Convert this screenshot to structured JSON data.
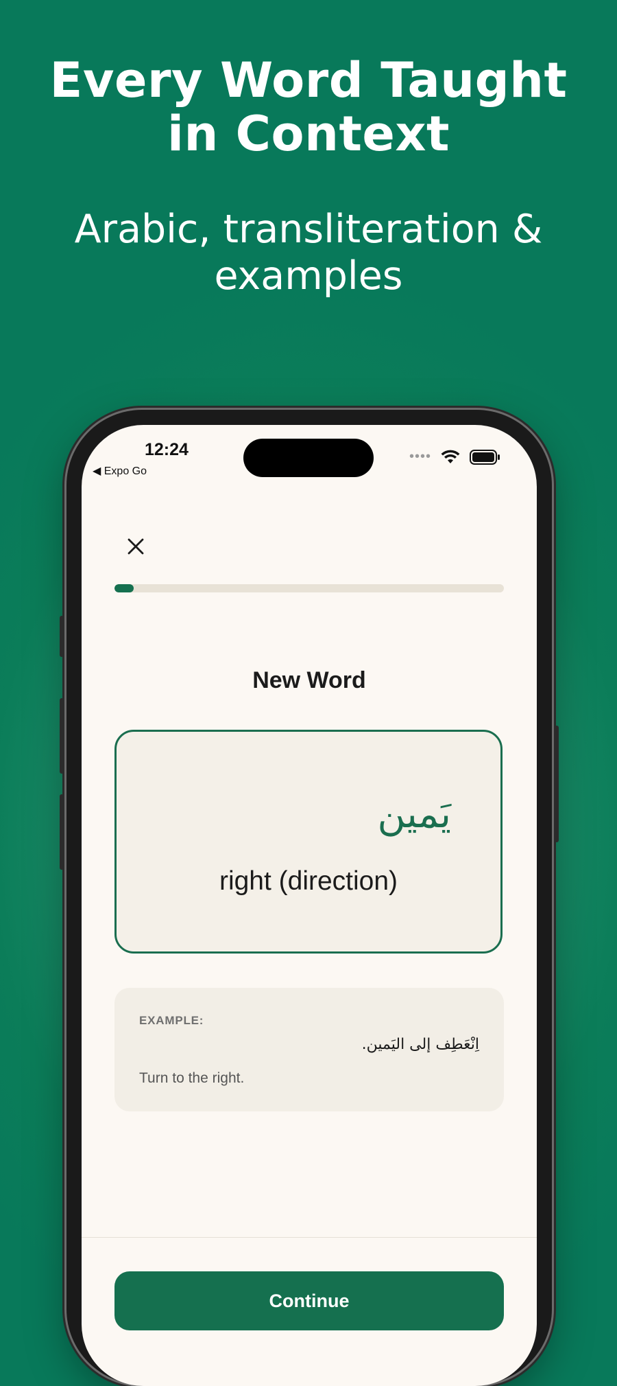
{
  "promo": {
    "headline_line1": "Every Word Taught",
    "headline_line2": "in Context",
    "subline_line1": "Arabic, transliteration &",
    "subline_line2": "examples"
  },
  "status_bar": {
    "time": "12:24",
    "back_label": "◀ Expo Go",
    "signal_icon": "signal-dots-icon",
    "wifi_icon": "wifi-icon",
    "battery_icon": "battery-icon"
  },
  "lesson": {
    "close_icon": "close-icon",
    "progress": 0.05,
    "title": "New Word",
    "arabic_word": "يَمين",
    "english_word": "right (direction)",
    "example": {
      "label": "EXAMPLE:",
      "arabic": "اِنْعَطِف إلى اليَمين.",
      "english": "Turn to the right."
    },
    "continue_label": "Continue"
  },
  "colors": {
    "brand_green": "#15704f",
    "background_green": "#0b7d59",
    "screen_bg": "#fcf8f3"
  }
}
